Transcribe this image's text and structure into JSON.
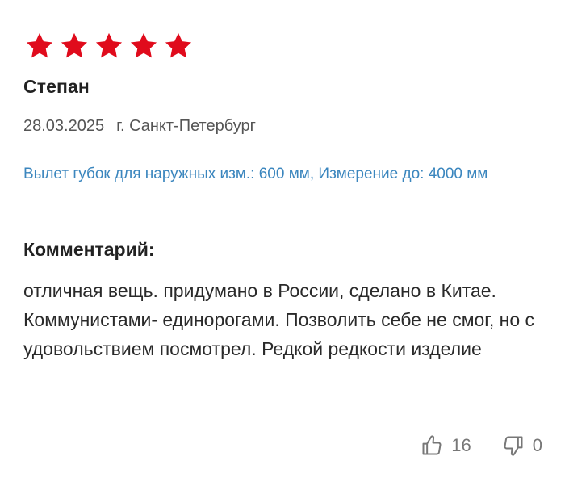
{
  "review": {
    "rating": 5,
    "rating_max": 5,
    "star_color": "#e00b1c",
    "author": "Степан",
    "date": "28.03.2025",
    "city": "г. Санкт-Петербург",
    "attributes": "Вылет губок для наружных изм.: 600 мм, Измерение до: 4000 мм",
    "comment_label": "Комментарий:",
    "comment": "отличная вещь. придумано в России, сделано в Китае. Коммунистами- единорогами. Позволить себе не смог, но с удовольствием посмотрел. Редкой редкости изделие",
    "likes": "16",
    "dislikes": "0",
    "icons": {
      "like": "thumbs-up-icon",
      "dislike": "thumbs-down-icon",
      "star": "star-icon"
    },
    "colors": {
      "attribute_text": "#3b86be",
      "meta_text": "#555555",
      "vote_text": "#777777"
    }
  }
}
